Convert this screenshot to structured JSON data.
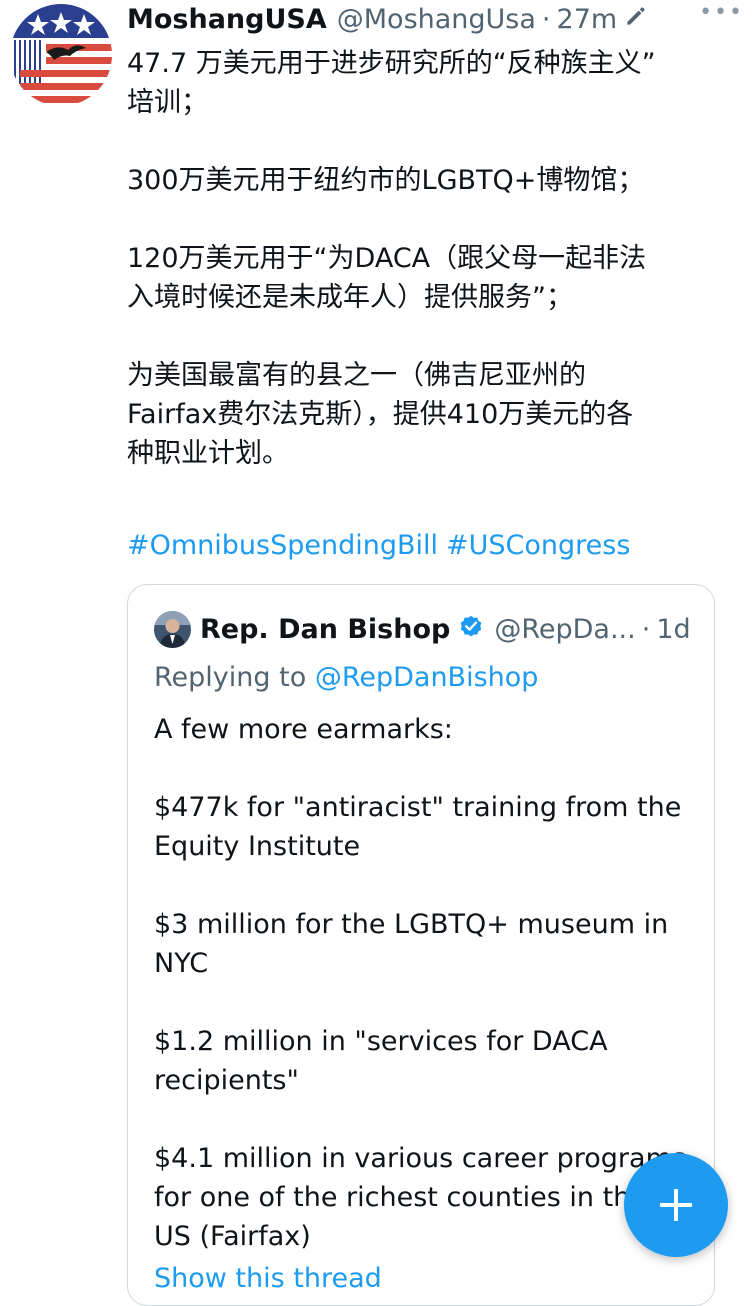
{
  "tweet": {
    "author_name": "MoshangUSA",
    "author_handle": "@MoshangUsa",
    "separator": "·",
    "time": "27m",
    "more_label": "•••",
    "paragraphs": [
      [
        "47.7 万美元用于进步研究所的“反种族主义”",
        "培训；"
      ],
      [
        "300万美元用于纽约市的LGBTQ+博物馆；"
      ],
      [
        "120万美元用于“为DACA（跟父母一起非法",
        "入境时候还是未成年人）提供服务”；"
      ],
      [
        "为美国最富有的县之一（佛吉尼亚州的",
        "Fairfax费尔法克斯），提供410万美元的各",
        "种职业计划。"
      ]
    ],
    "hashtags": [
      "#OmnibusSpendingBill",
      "#USCongress"
    ]
  },
  "quoted": {
    "author_name": "Rep. Dan Bishop",
    "author_handle": "@RepDa...",
    "separator": "·",
    "time": "1d",
    "replying_prefix": "Replying to ",
    "replying_to": "@RepDanBishop",
    "paragraphs": [
      [
        "A few more earmarks:"
      ],
      [
        "$477k for \"antiracist\" training from the",
        "Equity Institute"
      ],
      [
        "$3 million for the LGBTQ+ museum in",
        "NYC"
      ],
      [
        "$1.2 million in \"services for DACA",
        "recipients\""
      ],
      [
        "$4.1 million in various career programs",
        "for one of the richest counties in the",
        "US (Fairfax)"
      ]
    ],
    "show_thread": "Show this thread"
  },
  "colors": {
    "accent": "#1d9bf0",
    "secondary_text": "#536471",
    "border": "#cfd9de"
  },
  "icons": {
    "edit": "edit-pencil-icon",
    "more": "more-horizontal-icon",
    "verified": "verified-badge-icon",
    "compose": "plus-icon"
  }
}
